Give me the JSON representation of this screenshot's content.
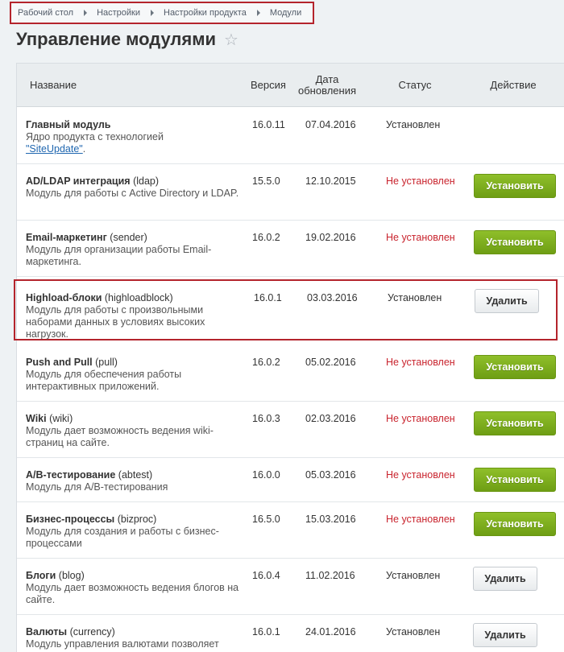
{
  "breadcrumb": [
    "Рабочий стол",
    "Настройки",
    "Настройки продукта",
    "Модули"
  ],
  "page": {
    "title": "Управление модулями",
    "star_icon": "star-icon"
  },
  "table": {
    "headers": {
      "name": "Название",
      "version": "Версия",
      "date": "Дата обновления",
      "status": "Статус",
      "action": "Действие"
    },
    "rows": [
      {
        "title": "Главный модуль",
        "code": "",
        "desc": "Ядро продукта с технологией",
        "link": "\"SiteUpdate\"",
        "after_link": ".",
        "version": "16.0.11",
        "date": "07.04.2016",
        "status": "Установлен",
        "installed": true,
        "action": ""
      },
      {
        "title": "AD/LDAP интеграция",
        "code": "(ldap)",
        "desc": "Модуль для работы с Active Directory и LDAP.",
        "version": "15.5.0",
        "date": "12.10.2015",
        "status": "Не установлен",
        "installed": false,
        "action": "Установить"
      },
      {
        "title": "Email-маркетинг",
        "code": "(sender)",
        "desc": "Модуль для организации работы Email-маркетинга.",
        "version": "16.0.2",
        "date": "19.02.2016",
        "status": "Не установлен",
        "installed": false,
        "action": "Установить"
      },
      {
        "title": "Highload-блоки",
        "code": "(highloadblock)",
        "desc": "Модуль для работы с произвольными наборами данных в условиях высоких нагрузок.",
        "version": "16.0.1",
        "date": "03.03.2016",
        "status": "Установлен",
        "installed": true,
        "action": "Удалить"
      },
      {
        "title": "Push and Pull",
        "code": "(pull)",
        "desc": "Модуль для обеспечения работы интерактивных приложений.",
        "version": "16.0.2",
        "date": "05.02.2016",
        "status": "Не установлен",
        "installed": false,
        "action": "Установить"
      },
      {
        "title": "Wiki",
        "code": "(wiki)",
        "desc": "Модуль дает возможность ведения wiki-страниц на сайте.",
        "version": "16.0.3",
        "date": "02.03.2016",
        "status": "Не установлен",
        "installed": false,
        "action": "Установить"
      },
      {
        "title": "A/B-тестирование",
        "code": "(abtest)",
        "desc": "Модуль для A/B-тестирования",
        "version": "16.0.0",
        "date": "05.03.2016",
        "status": "Не установлен",
        "installed": false,
        "action": "Установить"
      },
      {
        "title": "Бизнес-процессы",
        "code": "(bizproc)",
        "desc": "Модуль для создания и работы с бизнес-процессами",
        "version": "16.5.0",
        "date": "15.03.2016",
        "status": "Не установлен",
        "installed": false,
        "action": "Установить"
      },
      {
        "title": "Блоги",
        "code": "(blog)",
        "desc": "Модуль дает возможность ведения блогов на сайте.",
        "version": "16.0.4",
        "date": "11.02.2016",
        "status": "Установлен",
        "installed": true,
        "action": "Удалить"
      },
      {
        "title": "Валюты",
        "code": "(currency)",
        "desc": "Модуль управления валютами позволяет",
        "version": "16.0.1",
        "date": "24.01.2016",
        "status": "Установлен",
        "installed": true,
        "action": "Удалить"
      }
    ]
  },
  "colors": {
    "install_button": "#7aad1c",
    "not_installed": "#c9242e",
    "highlight_border": "#b4242c"
  }
}
